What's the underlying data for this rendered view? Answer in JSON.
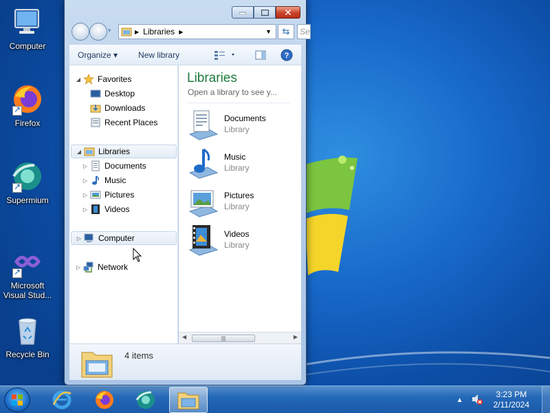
{
  "desktop": {
    "icons": [
      {
        "label": "Computer"
      },
      {
        "label": "Firefox"
      },
      {
        "label": "Supermium"
      },
      {
        "label": "Microsoft Visual Stud..."
      },
      {
        "label": "Recycle Bin"
      }
    ]
  },
  "window": {
    "address": {
      "location": "Libraries",
      "search_placeholder": "Sear"
    },
    "toolbar": {
      "organize": "Organize ▾",
      "new_library": "New library"
    },
    "nav": {
      "favorites": "Favorites",
      "favorites_items": [
        "Desktop",
        "Downloads",
        "Recent Places"
      ],
      "libraries": "Libraries",
      "libraries_items": [
        "Documents",
        "Music",
        "Pictures",
        "Videos"
      ],
      "computer": "Computer",
      "network": "Network"
    },
    "content": {
      "title": "Libraries",
      "subtitle": "Open a library to see y...",
      "items": [
        {
          "name": "Documents",
          "type": "Library"
        },
        {
          "name": "Music",
          "type": "Library"
        },
        {
          "name": "Pictures",
          "type": "Library"
        },
        {
          "name": "Videos",
          "type": "Library"
        }
      ]
    },
    "details": {
      "count": "4 items"
    }
  },
  "taskbar": {
    "time": "3:23 PM",
    "date": "2/11/2024"
  },
  "colors": {
    "title_green": "#1e7b3f",
    "close_red": "#c8432a",
    "wallpaper_blue": "#1768c9"
  }
}
